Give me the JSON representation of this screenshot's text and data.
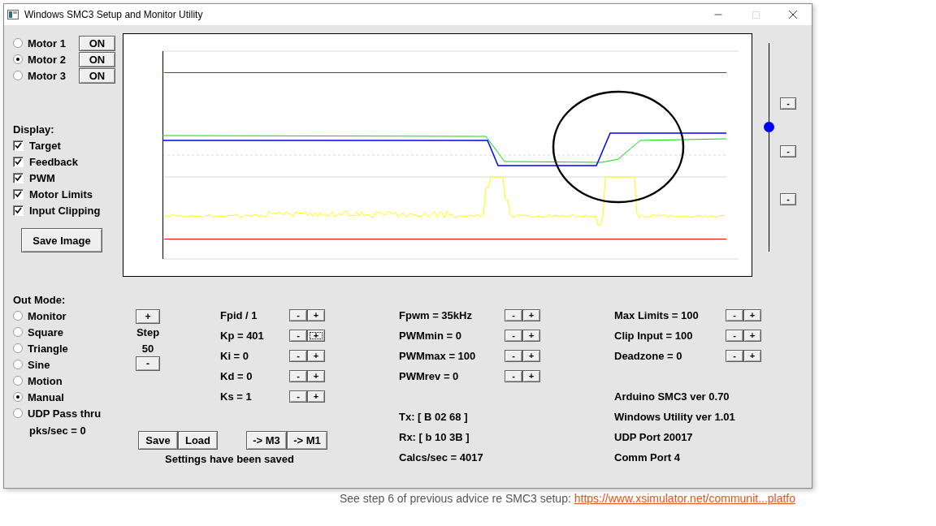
{
  "window": {
    "title": "Windows SMC3 Setup and Monitor Utility"
  },
  "motors": [
    {
      "label": "Motor 1",
      "selected": false,
      "button": "ON"
    },
    {
      "label": "Motor 2",
      "selected": true,
      "button": "ON"
    },
    {
      "label": "Motor 3",
      "selected": false,
      "button": "ON"
    }
  ],
  "display": {
    "label": "Display:",
    "options": [
      {
        "label": "Target",
        "checked": true
      },
      {
        "label": "Feedback",
        "checked": true
      },
      {
        "label": "PWM",
        "checked": true
      },
      {
        "label": "Motor Limits",
        "checked": true
      },
      {
        "label": "Input Clipping",
        "checked": true
      }
    ]
  },
  "save_image_button": "Save Image",
  "slider": {
    "level": 0.6,
    "buttons": [
      "-",
      "-",
      "-"
    ]
  },
  "out_mode": {
    "label": "Out Mode:",
    "options": [
      {
        "label": "Monitor",
        "selected": false
      },
      {
        "label": "Square",
        "selected": false
      },
      {
        "label": "Triangle",
        "selected": false
      },
      {
        "label": "Sine",
        "selected": false
      },
      {
        "label": "Motion",
        "selected": false
      },
      {
        "label": "Manual",
        "selected": true
      },
      {
        "label": "UDP Pass thru",
        "selected": false
      }
    ],
    "packets": "pks/sec = 0"
  },
  "step": {
    "plus": "+",
    "label": "Step",
    "value": "50",
    "minus": "-"
  },
  "pid_params": [
    {
      "label": "Fpid / 1",
      "minus": "-",
      "plus": "+",
      "focused": false
    },
    {
      "label": "Kp = 401",
      "minus": "-",
      "plus": "+",
      "focused": true
    },
    {
      "label": "Ki = 0",
      "minus": "-",
      "plus": "+",
      "focused": false
    },
    {
      "label": "Kd = 0",
      "minus": "-",
      "plus": "+",
      "focused": false
    },
    {
      "label": "Ks = 1",
      "minus": "-",
      "plus": "+",
      "focused": false
    }
  ],
  "pwm_params": [
    {
      "label": "Fpwm = 35kHz",
      "minus": "-",
      "plus": "+",
      "focused": false
    },
    {
      "label": "PWMmin = 0",
      "minus": "-",
      "plus": "+",
      "focused": false
    },
    {
      "label": "PWMmax = 100",
      "minus": "-",
      "plus": "+",
      "focused": false
    },
    {
      "label": "PWMrev = 0",
      "minus": "-",
      "plus": "+",
      "focused": false
    }
  ],
  "limit_params": [
    {
      "label": "Max Limits = 100",
      "minus": "-",
      "plus": "+",
      "focused": false
    },
    {
      "label": "Clip Input = 100",
      "minus": "-",
      "plus": "+",
      "focused": false
    },
    {
      "label": "Deadzone = 0",
      "minus": "-",
      "plus": "+",
      "focused": false
    }
  ],
  "file_buttons": [
    "Save",
    "Load"
  ],
  "copy_buttons": [
    "-> M3",
    "-> M1"
  ],
  "status_message": "Settings have been saved",
  "comms": [
    "Tx: [ B 02 68 ]",
    "Rx: [ b 10 3B ]",
    "Calcs/sec = 4017"
  ],
  "info": [
    "Arduino SMC3 ver 0.70",
    "Windows Utility ver 1.01",
    "UDP Port 20017",
    "Comm Port 4"
  ],
  "background_page": {
    "text": "See step 6 of previous advice re SMC3 setup:",
    "link": "https://www.xsimulator.net/communit...platfo"
  }
}
